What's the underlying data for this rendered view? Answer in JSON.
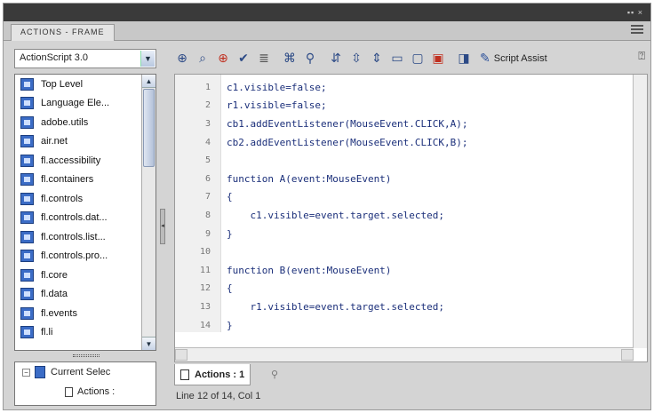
{
  "panel": {
    "tab_label": "ACTIONS - FRAME"
  },
  "language": {
    "selected": "ActionScript 3.0"
  },
  "toolbox": {
    "items": [
      "Top Level",
      "Language Ele...",
      "adobe.utils",
      "air.net",
      "fl.accessibility",
      "fl.containers",
      "fl.controls",
      "fl.controls.dat...",
      "fl.controls.list...",
      "fl.controls.pro...",
      "fl.core",
      "fl.data",
      "fl.events",
      "fl.li"
    ]
  },
  "script_navigator": {
    "current_selection": "Current Selec",
    "actions_item": "Actions :"
  },
  "toolbar": {
    "script_assist_label": "Script Assist"
  },
  "editor": {
    "lines": [
      {
        "n": "1",
        "code": "c1.visible=false;"
      },
      {
        "n": "2",
        "code": "r1.visible=false;"
      },
      {
        "n": "3",
        "code": "cb1.addEventListener(MouseEvent.CLICK,A);"
      },
      {
        "n": "4",
        "code": "cb2.addEventListener(MouseEvent.CLICK,B);"
      },
      {
        "n": "5",
        "code": ""
      },
      {
        "n": "6",
        "code": "function A(event:MouseEvent)"
      },
      {
        "n": "7",
        "code": "{"
      },
      {
        "n": "8",
        "code": "    c1.visible=event.target.selected;"
      },
      {
        "n": "9",
        "code": "}"
      },
      {
        "n": "10",
        "code": ""
      },
      {
        "n": "11",
        "code": "function B(event:MouseEvent)"
      },
      {
        "n": "12",
        "code": "{"
      },
      {
        "n": "13",
        "code": "    r1.visible=event.target.selected;"
      },
      {
        "n": "14",
        "code": "}"
      }
    ]
  },
  "script_tab": {
    "label": "Actions : 1"
  },
  "status": {
    "text": "Line 12 of 14, Col 1"
  }
}
